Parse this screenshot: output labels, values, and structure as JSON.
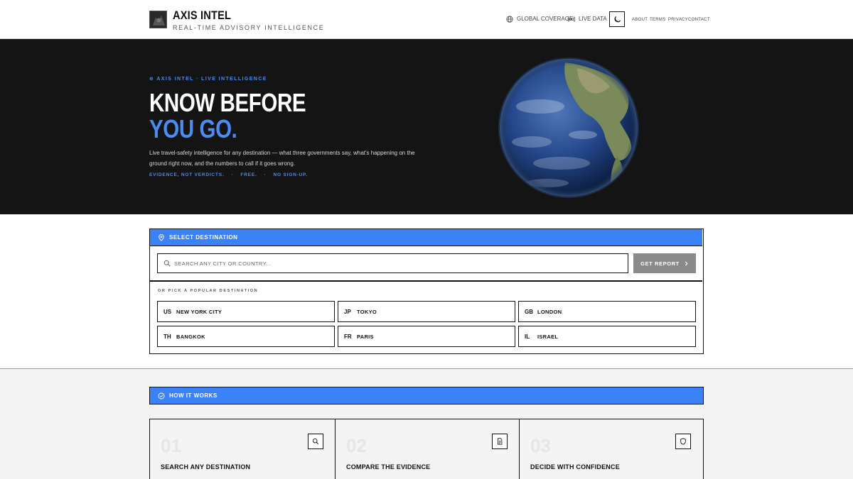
{
  "header": {
    "brand_title": "AXIS INTEL",
    "brand_subtitle": "REAL-TIME ADVISORY INTELLIGENCE",
    "global_coverage": "GLOBAL COVERAGE",
    "live_data": "LIVE DATA",
    "separator": "·",
    "nav": [
      "ABOUT",
      "TERMS",
      "PRIVACY",
      "CONTACT"
    ]
  },
  "hero": {
    "kicker": "⊕ AXIS INTEL · LIVE INTELLIGENCE",
    "headline_line1": "KNOW BEFORE",
    "headline_line2": "YOU GO.",
    "description": "Live travel-safety intelligence for any destination — what three governments say, what's happening on the ground right now, and the numbers to call if it goes wrong.",
    "tags": [
      "EVIDENCE, NOT VERDICTS.",
      "FREE.",
      "NO SIGN-UP."
    ],
    "tag_separator": "·"
  },
  "select": {
    "title": "SELECT DESTINATION",
    "search_placeholder": "SEARCH ANY CITY OR COUNTRY...",
    "report_button": "GET REPORT",
    "pick_label": "OR PICK A POPULAR DESTINATION",
    "destinations": [
      {
        "code": "US",
        "city": "NEW YORK CITY"
      },
      {
        "code": "JP",
        "city": "TOKYO"
      },
      {
        "code": "GB",
        "city": "LONDON"
      },
      {
        "code": "TH",
        "city": "BANGKOK"
      },
      {
        "code": "FR",
        "city": "PARIS"
      },
      {
        "code": "IL",
        "city": "ISRAEL"
      }
    ]
  },
  "how": {
    "title": "HOW IT WORKS",
    "steps": [
      {
        "num": "01",
        "title": "SEARCH ANY DESTINATION",
        "icon": "search-icon"
      },
      {
        "num": "02",
        "title": "COMPARE THE EVIDENCE",
        "icon": "document-icon"
      },
      {
        "num": "03",
        "title": "DECIDE WITH CONFIDENCE",
        "icon": "shield-icon"
      }
    ]
  },
  "colors": {
    "accent": "#3b82f6",
    "hero_bg": "#141414",
    "button_disabled": "#8a8a8a"
  }
}
